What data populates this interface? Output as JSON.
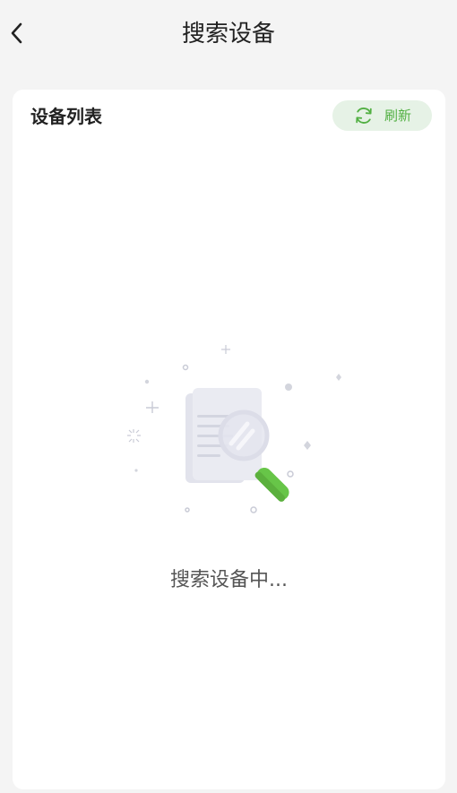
{
  "header": {
    "title": "搜索设备"
  },
  "card": {
    "title": "设备列表",
    "refresh_label": "刷新"
  },
  "empty_state": {
    "status_text": "搜索设备中..."
  },
  "icons": {
    "back": "chevron-left-icon",
    "refresh": "refresh-icon",
    "search_illustration": "document-magnifier-illustration"
  },
  "colors": {
    "accent": "#52b043",
    "refresh_bg": "#e6f2e6",
    "page_bg": "#f4f4f4"
  }
}
